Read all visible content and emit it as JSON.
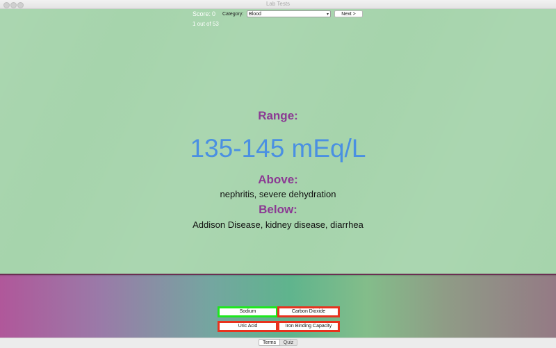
{
  "window": {
    "title": "Lab Tests"
  },
  "header": {
    "score_label": "Score:",
    "score_value": "0",
    "category_label": "Category:",
    "category_selected": "Blood",
    "next_label": "Next >",
    "progress": "1 out of 53"
  },
  "card": {
    "range_heading": "Range:",
    "range_value": "135-145 mEq/L",
    "above_heading": "Above:",
    "above_text": "nephritis,  severe dehydration",
    "below_heading": "Below:",
    "below_text": "Addison Disease, kidney disease, diarrhea"
  },
  "answers": [
    {
      "label": "Sodium",
      "state": "correct",
      "color": "#1ee81e"
    },
    {
      "label": "Carbon Dioxide",
      "state": "wrong",
      "color": "#e8321e"
    },
    {
      "label": "Uric Acid",
      "state": "wrong",
      "color": "#e8321e"
    },
    {
      "label": "Iron Binding Capacity",
      "state": "wrong",
      "color": "#e8321e"
    }
  ],
  "modes": {
    "terms": "Terms",
    "quiz": "Quiz",
    "selected": "Terms"
  },
  "colors": {
    "heading": "#8b3a93",
    "range_value": "#4a90e2",
    "background": "#a6d4ac"
  }
}
